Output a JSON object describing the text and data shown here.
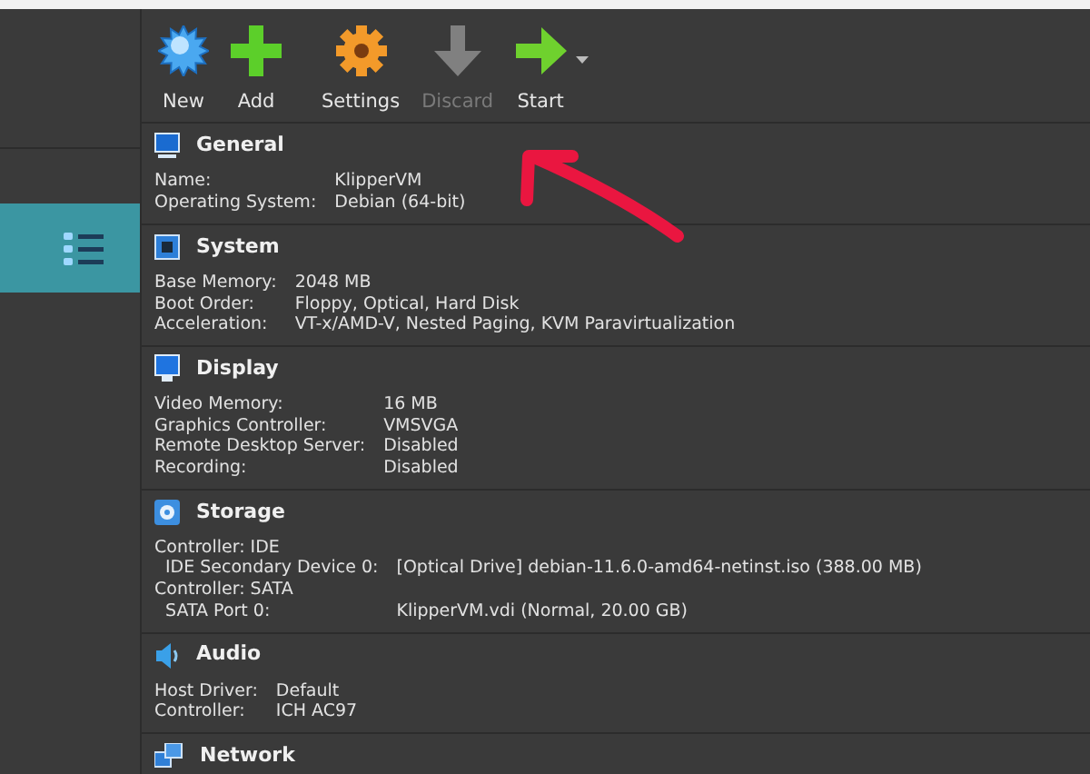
{
  "sidebar": {
    "items": [
      {
        "selected": true
      }
    ]
  },
  "toolbar": [
    {
      "kind": "new",
      "label": "New",
      "disabled": false,
      "dropdown": false
    },
    {
      "kind": "add",
      "label": "Add",
      "disabled": false,
      "dropdown": false
    },
    {
      "kind": "settings",
      "label": "Settings",
      "disabled": false,
      "dropdown": false
    },
    {
      "kind": "discard",
      "label": "Discard",
      "disabled": true,
      "dropdown": false
    },
    {
      "kind": "start",
      "label": "Start",
      "disabled": false,
      "dropdown": true
    }
  ],
  "sections": [
    {
      "kind": "general",
      "title": "General",
      "rows": [
        {
          "label": "Name:",
          "value": "KlipperVM"
        },
        {
          "label": "Operating System:",
          "value": "Debian (64-bit)"
        }
      ]
    },
    {
      "kind": "system",
      "title": "System",
      "rows": [
        {
          "label": "Base Memory:",
          "value": "2048 MB"
        },
        {
          "label": "Boot Order:",
          "value": "Floppy, Optical, Hard Disk"
        },
        {
          "label": "Acceleration:",
          "value": "VT-x/AMD-V, Nested Paging, KVM Paravirtualization"
        }
      ]
    },
    {
      "kind": "display",
      "title": "Display",
      "rows": [
        {
          "label": "Video Memory:",
          "value": "16 MB"
        },
        {
          "label": "Graphics Controller:",
          "value": "VMSVGA"
        },
        {
          "label": "Remote Desktop Server:",
          "value": "Disabled"
        },
        {
          "label": "Recording:",
          "value": "Disabled"
        }
      ]
    },
    {
      "kind": "storage",
      "title": "Storage",
      "rows": [
        {
          "label": "Controller: IDE",
          "children": [
            {
              "label": "IDE Secondary Device 0:",
              "value": "[Optical Drive] debian-11.6.0-amd64-netinst.iso (388.00 MB)"
            }
          ]
        },
        {
          "label": "Controller: SATA",
          "children": [
            {
              "label": "SATA Port 0:",
              "value": "KlipperVM.vdi (Normal, 20.00 GB)"
            }
          ]
        }
      ]
    },
    {
      "kind": "audio",
      "title": "Audio",
      "rows": [
        {
          "label": "Host Driver:",
          "value": "Default"
        },
        {
          "label": "Controller:",
          "value": "ICH AC97"
        }
      ]
    },
    {
      "kind": "network",
      "title": "Network"
    }
  ]
}
